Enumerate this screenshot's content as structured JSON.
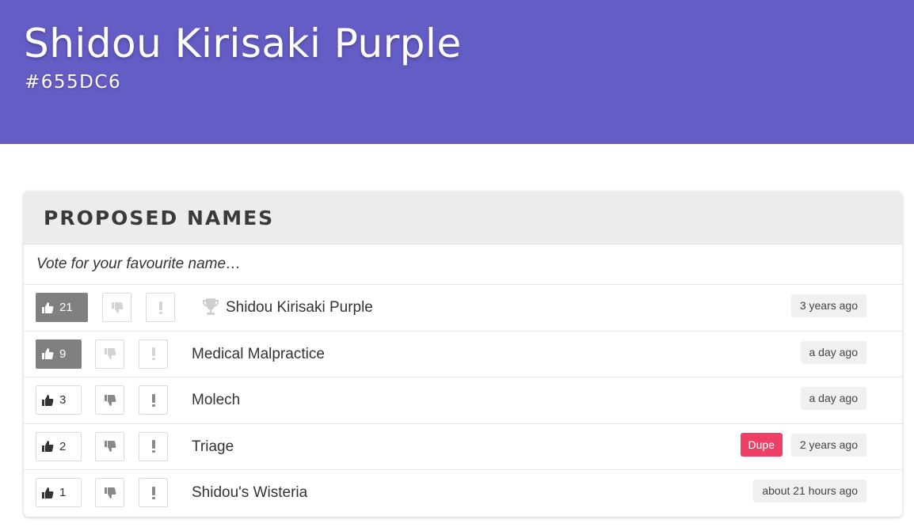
{
  "hero": {
    "title": "Shidou Kirisaki Purple",
    "hex": "#655DC6",
    "background_color": "#655DC6"
  },
  "panel": {
    "title": "PROPOSED NAMES",
    "prompt": "Vote for your favourite name…"
  },
  "names": [
    {
      "votes": "21",
      "name": "Shidou Kirisaki Purple",
      "time": "3 years ago",
      "voted": true,
      "winner": true
    },
    {
      "votes": "9",
      "name": "Medical Malpractice",
      "time": "a day ago",
      "voted": true
    },
    {
      "votes": "3",
      "name": "Molech",
      "time": "a day ago",
      "voted": false
    },
    {
      "votes": "2",
      "name": "Triage",
      "time": "2 years ago",
      "voted": false,
      "badge": "Dupe"
    },
    {
      "votes": "1",
      "name": "Shidou's Wisteria",
      "time": "about 21 hours ago",
      "voted": false
    }
  ],
  "icons": {
    "upvote": "thumbs-up-icon",
    "downvote": "thumbs-down-icon",
    "flag": "exclamation-icon",
    "winner": "trophy-icon"
  },
  "colors": {
    "dupe_badge": "#ee3f66",
    "active_vote": "#808080"
  }
}
